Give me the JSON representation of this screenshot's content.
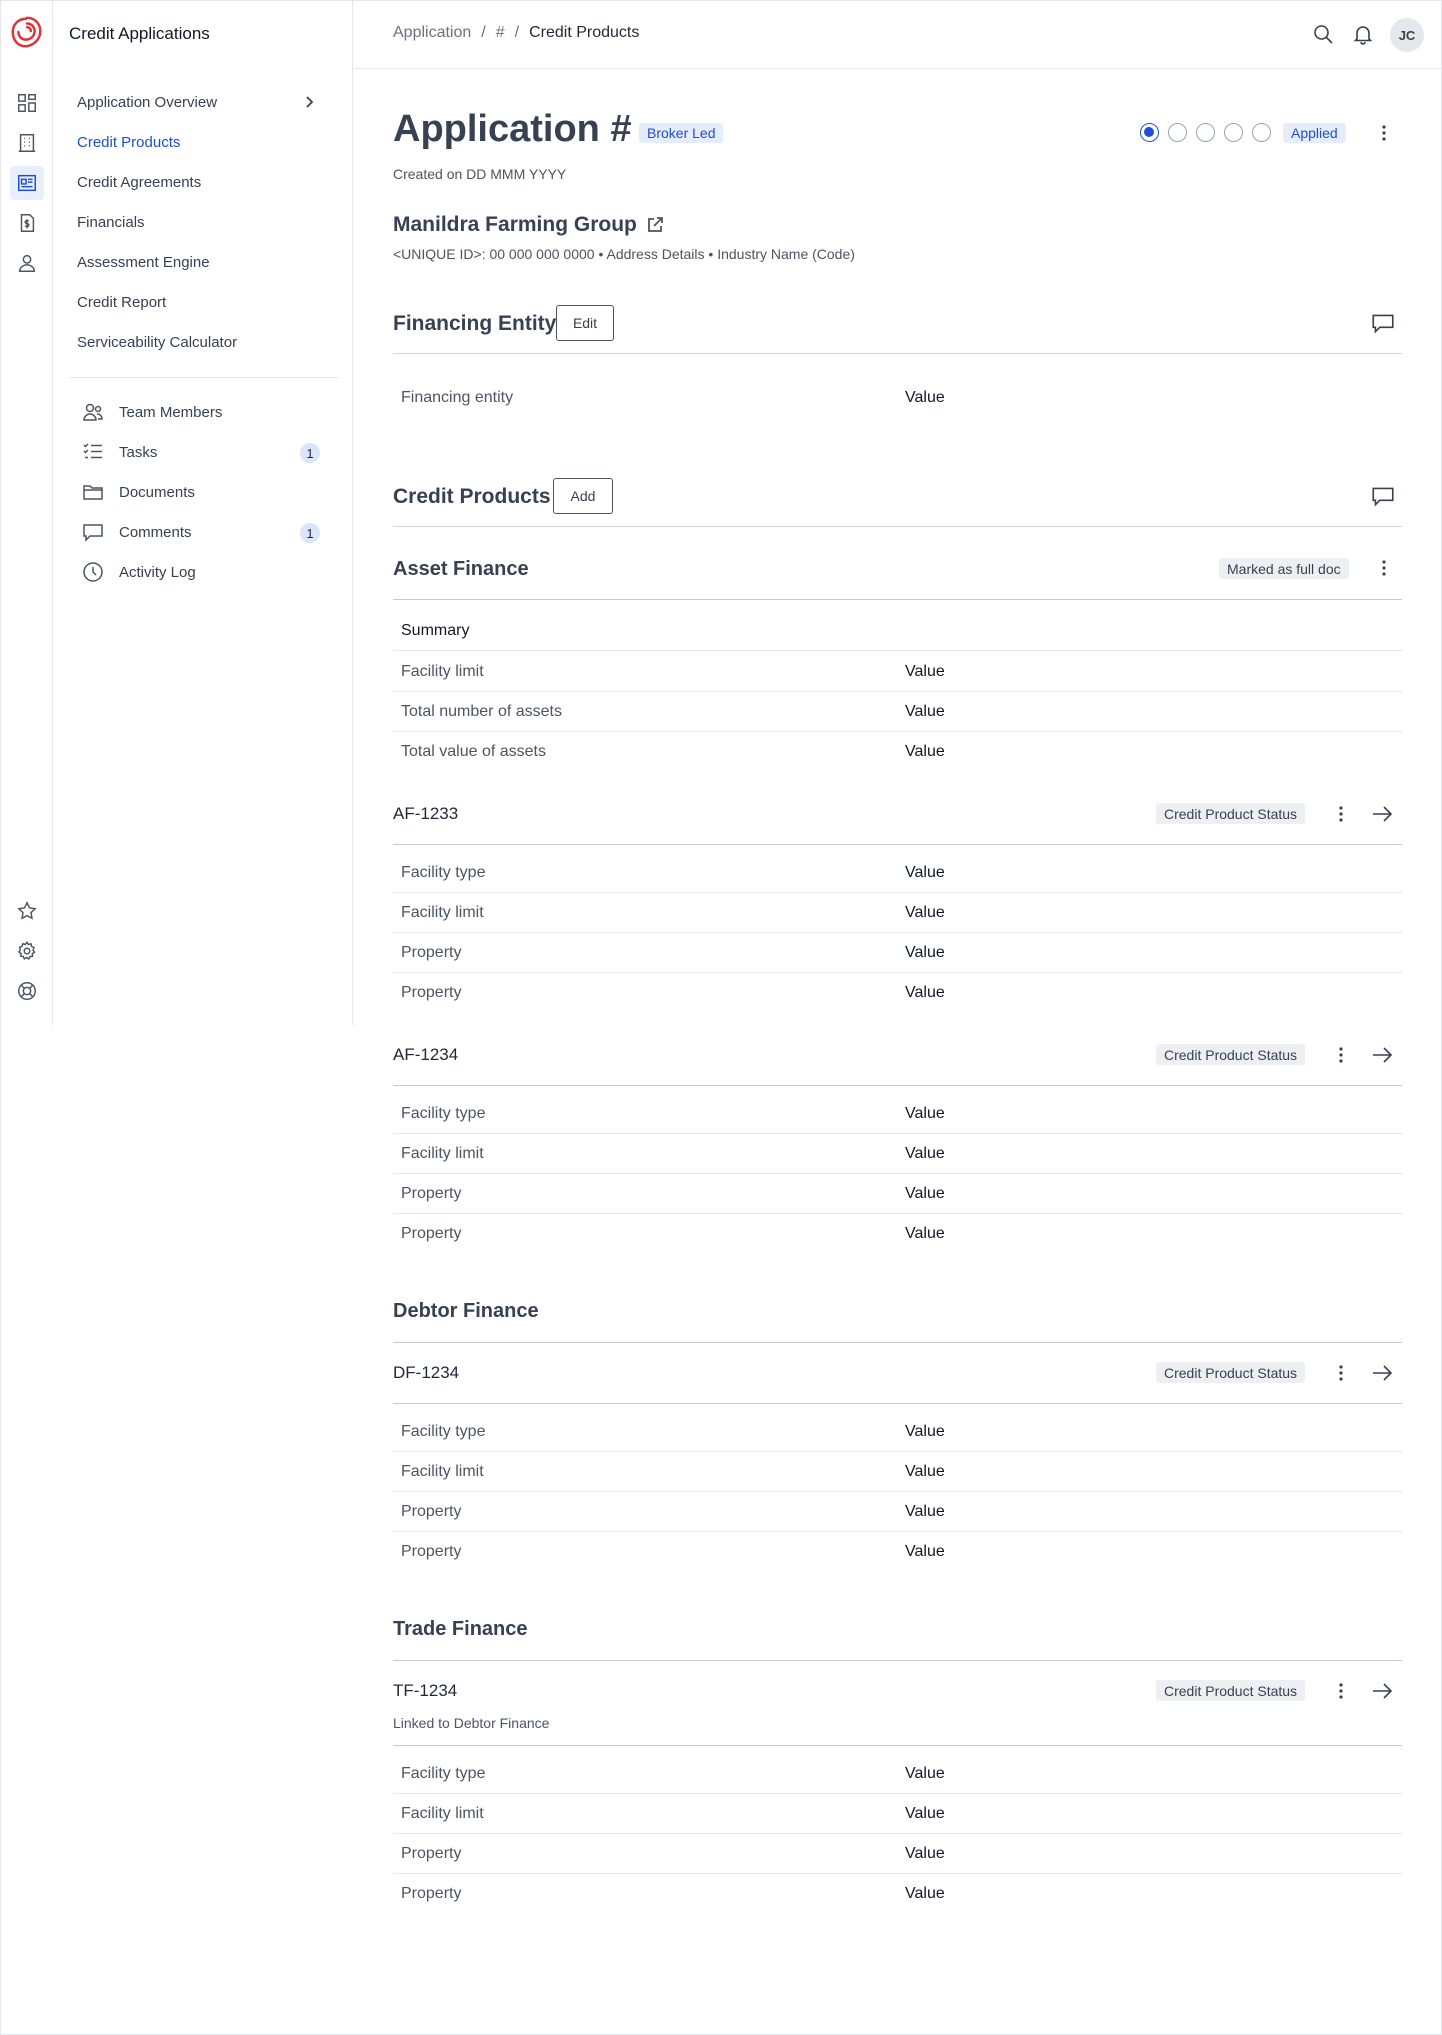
{
  "app": {
    "title": "Credit Applications"
  },
  "rail": {
    "icons": [
      "dashboard-icon",
      "building-icon",
      "applications-icon",
      "billing-icon",
      "user-icon",
      "star-icon",
      "gear-icon",
      "help-icon"
    ]
  },
  "sidebar": {
    "items": [
      {
        "label": "Application Overview"
      },
      {
        "label": "Credit Products"
      },
      {
        "label": "Credit Agreements"
      },
      {
        "label": "Financials"
      },
      {
        "label": "Assessment Engine"
      },
      {
        "label": "Credit Report"
      },
      {
        "label": "Serviceability Calculator"
      }
    ],
    "tools": [
      {
        "label": "Team Members",
        "badge": ""
      },
      {
        "label": "Tasks",
        "badge": "1"
      },
      {
        "label": "Documents",
        "badge": ""
      },
      {
        "label": "Comments",
        "badge": "1"
      },
      {
        "label": "Activity Log",
        "badge": ""
      }
    ]
  },
  "header": {
    "breadcrumb": [
      "Application",
      "/",
      "#",
      "/",
      "Credit Products"
    ],
    "avatar": "JC"
  },
  "page": {
    "title": "Application #",
    "tag": "Broker Led",
    "created": "Created on DD MMM YYYY",
    "status": "Applied",
    "company": "Manildra Farming Group",
    "company_meta": "<UNIQUE ID>: 00 000 000 0000 • Address Details • Industry Name (Code)"
  },
  "financing_entity": {
    "title": "Financing Entity",
    "button": "Edit",
    "label": "Financing entity",
    "value": "Value"
  },
  "credit_products": {
    "title": "Credit Products",
    "button": "Add",
    "asset_finance": {
      "title": "Asset Finance",
      "tag": "Marked as full doc",
      "summary_label": "Summary",
      "summary": [
        {
          "label": "Facility limit",
          "value": "Value"
        },
        {
          "label": "Total number of assets",
          "value": "Value"
        },
        {
          "label": "Total value of assets",
          "value": "Value"
        }
      ],
      "products": [
        {
          "id": "AF-1233",
          "status": "Credit Product Status",
          "rows": [
            {
              "label": "Facility type",
              "value": "Value"
            },
            {
              "label": "Facility limit",
              "value": "Value"
            },
            {
              "label": "Property",
              "value": "Value"
            },
            {
              "label": "Property",
              "value": "Value"
            }
          ]
        },
        {
          "id": "AF-1234",
          "status": "Credit Product Status",
          "rows": [
            {
              "label": "Facility type",
              "value": "Value"
            },
            {
              "label": "Facility limit",
              "value": "Value"
            },
            {
              "label": "Property",
              "value": "Value"
            },
            {
              "label": "Property",
              "value": "Value"
            }
          ]
        }
      ]
    },
    "debtor_finance": {
      "title": "Debtor Finance",
      "products": [
        {
          "id": "DF-1234",
          "status": "Credit Product Status",
          "rows": [
            {
              "label": "Facility type",
              "value": "Value"
            },
            {
              "label": "Facility limit",
              "value": "Value"
            },
            {
              "label": "Property",
              "value": "Value"
            },
            {
              "label": "Property",
              "value": "Value"
            }
          ]
        }
      ]
    },
    "trade_finance": {
      "title": "Trade Finance",
      "products": [
        {
          "id": "TF-1234",
          "status": "Credit Product Status",
          "note": "Linked to Debtor Finance",
          "rows": [
            {
              "label": "Facility type",
              "value": "Value"
            },
            {
              "label": "Facility limit",
              "value": "Value"
            },
            {
              "label": "Property",
              "value": "Value"
            },
            {
              "label": "Property",
              "value": "Value"
            }
          ]
        }
      ]
    }
  }
}
